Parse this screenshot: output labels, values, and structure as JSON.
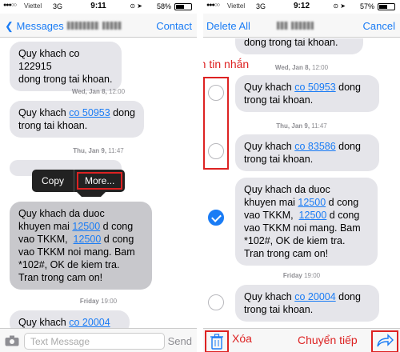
{
  "left": {
    "status": {
      "carrier": "Viettel",
      "network": "3G",
      "time": "9:11",
      "battery": "58%",
      "battery_fraction": 0.58
    },
    "nav": {
      "back": "Messages",
      "action": "Contact"
    },
    "messages": [
      {
        "lines": [
          "Quy khach co 122915",
          "dong trong tai khoan."
        ]
      },
      {
        "lines": [
          "Quy khach co 50953 dong",
          "trong tai khoan."
        ],
        "link": "co 50953"
      },
      {
        "lines": [
          "Quy khach da duoc",
          "khuyen mai 12500 d cong",
          "vao TKKM, 12500 d cong",
          "vao TKKM noi mang. Bam",
          "*102#, OK de kiem tra.",
          "Tran trong cam on!"
        ]
      },
      {
        "lines": [
          "Quy khach co 20004"
        ]
      }
    ],
    "timestamps": [
      {
        "day": "Wed, Jan 8,",
        "time": "12:00"
      },
      {
        "day": "Thu, Jan 9,",
        "time": "11:47"
      },
      {
        "day": "Friday",
        "time": "19:00"
      }
    ],
    "menu": {
      "copy": "Copy",
      "more": "More..."
    },
    "input": {
      "placeholder": "Text Message",
      "send": "Send"
    }
  },
  "right": {
    "status": {
      "carrier": "Viettel",
      "network": "3G",
      "time": "9:12",
      "battery": "57%",
      "battery_fraction": 0.57
    },
    "nav": {
      "left": "Delete All",
      "right": "Cancel"
    },
    "top_fragment": "dong trong tai khoan.",
    "messages": [
      {
        "pre": "Quy khach ",
        "link": "co 50953",
        "post": " dong",
        "line2": "trong tai khoan.",
        "checked": false
      },
      {
        "pre": "Quy khach ",
        "link": "co 83586",
        "post": " dong",
        "line2": "trong tai khoan.",
        "checked": false
      },
      {
        "lines": [
          "Quy khach da duoc",
          "khuyen mai 12500 d cong",
          "vao TKKM, 12500 d cong",
          "vao TKKM noi mang. Bam",
          "*102#, OK de kiem tra.",
          "Tran trong cam on!"
        ],
        "checked": true
      },
      {
        "pre": "Quy khach ",
        "link": "co 20004",
        "post": " dong",
        "line2": "trong tai khoan.",
        "checked": false
      }
    ],
    "timestamps": [
      {
        "day": "Wed, Jan 8,",
        "time": "12:00"
      },
      {
        "day": "Thu, Jan 9,",
        "time": "11:47"
      },
      {
        "day": "Friday",
        "time": "19:00"
      }
    ],
    "annotations": {
      "select": "Chọn tin nhắn",
      "delete": "Xóa",
      "forward": "Chuyển tiếp"
    }
  },
  "colors": {
    "accent": "#1a7cf5",
    "annotation": "#dd2222",
    "bubble": "#e5e5ea"
  }
}
